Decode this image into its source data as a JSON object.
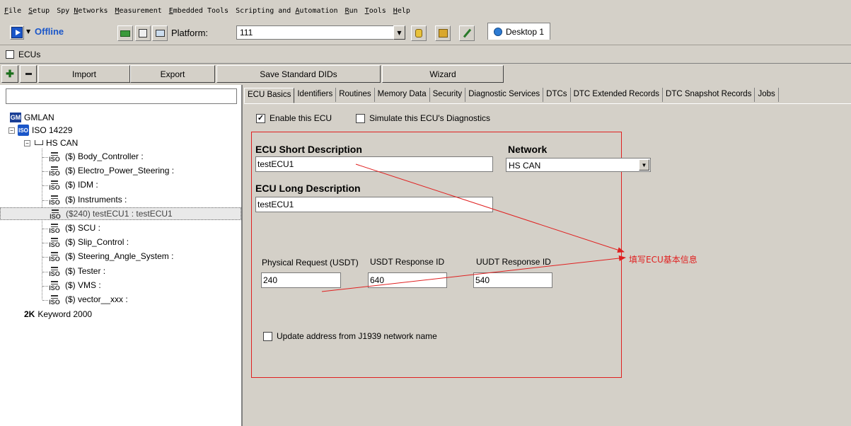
{
  "menu": [
    {
      "label": "File",
      "u": "F",
      "rest": "ile"
    },
    {
      "label": "Setup",
      "u": "S",
      "rest": "etup"
    },
    {
      "label": "Spy Networks",
      "pre": "Spy ",
      "u": "N",
      "rest": "etworks"
    },
    {
      "label": "Measurement",
      "u": "M",
      "rest": "easurement"
    },
    {
      "label": "Embedded Tools",
      "u": "E",
      "rest": "mbedded Tools"
    },
    {
      "label": "Scripting and Automation",
      "pre": "Scripting and ",
      "u": "A",
      "rest": "utomation"
    },
    {
      "label": "Run",
      "u": "R",
      "rest": "un"
    },
    {
      "label": "Tools",
      "u": "T",
      "rest": "ools"
    },
    {
      "label": "Help",
      "u": "H",
      "rest": "elp"
    }
  ],
  "toolbar": {
    "status": "Offline",
    "platform_label": "Platform:",
    "platform_value": "111",
    "desktop_tab": "Desktop 1"
  },
  "subbar": {
    "title": "ECUs"
  },
  "buttons": {
    "import": "Import",
    "export": "Export",
    "save_dids": "Save Standard DIDs",
    "wizard": "Wizard"
  },
  "tree": {
    "gmlan": "GMLAN",
    "iso": "ISO 14229",
    "hscan": "HS CAN",
    "ecus": [
      "($) Body_Controller :",
      "($) Electro_Power_Steering :",
      "($) IDM :",
      "($) Instruments :",
      "($240) testECU1 : testECU1",
      "($) SCU :",
      "($) Slip_Control :",
      "($) Steering_Angle_System :",
      "($) Tester :",
      "($) VMS :",
      "($) vector__xxx :"
    ],
    "keyword": "Keyword 2000",
    "iso_icon_text": "ISO",
    "gm_icon_text": "GM",
    "kw_icon_text": "2K"
  },
  "tabs": [
    "ECU Basics",
    "Identifiers",
    "Routines",
    "Memory Data",
    "Security",
    "Diagnostic Services",
    "DTCs",
    "DTC Extended Records",
    "DTC Snapshot Records",
    "Jobs"
  ],
  "form": {
    "enable_label": "Enable this ECU",
    "simulate_label": "Simulate this ECU's Diagnostics",
    "short_desc_label": "ECU Short Description",
    "short_desc_value": "testECU1",
    "network_label": "Network",
    "network_value": "HS CAN",
    "long_desc_label": "ECU Long Description",
    "long_desc_value": "testECU1",
    "phys_req_label": "Physical Request  (USDT)",
    "phys_req_value": "240",
    "usdt_resp_label": "USDT Response ID",
    "usdt_resp_value": "640",
    "uudt_resp_label": "UUDT Response ID",
    "uudt_resp_value": "540",
    "j1939_label": "Update address from J1939 network name"
  },
  "annotation": "填写ECU基本信息",
  "colors": {
    "annotation": "#e02020",
    "accent": "#1a56c9"
  }
}
